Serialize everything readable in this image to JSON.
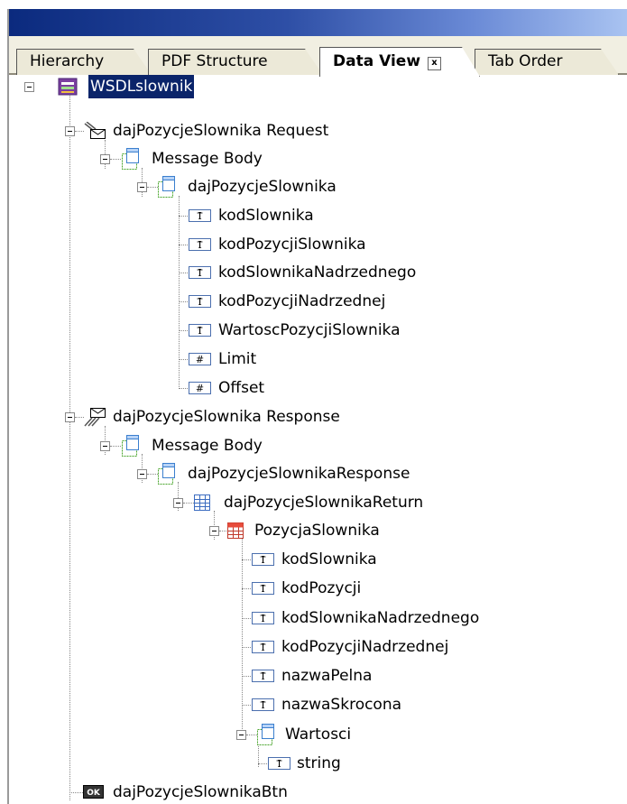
{
  "tabs": [
    {
      "label": "Hierarchy"
    },
    {
      "label": "PDF Structure"
    },
    {
      "label": "Data View",
      "close": "x"
    },
    {
      "label": "Tab Order"
    }
  ],
  "tree": {
    "root": "WSDLslownik",
    "request": {
      "label": "dajPozycjeSlownika Request",
      "body": "Message Body",
      "element": "dajPozycjeSlownika",
      "fields": [
        "kodSlownika",
        "kodPozycjiSlownika",
        "kodSlownikaNadrzednego",
        "kodPozycjiNadrzednej",
        "WartoscPozycjiSlownika",
        "Limit",
        "Offset"
      ]
    },
    "response": {
      "label": "dajPozycjeSlownika Response",
      "body": "Message Body",
      "element": "dajPozycjeSlownikaResponse",
      "return": "dajPozycjeSlownikaReturn",
      "item": "PozycjaSlownika",
      "fields": [
        "kodSlownika",
        "kodPozycji",
        "kodSlownikaNadrzednego",
        "kodPozycjiNadrzednej",
        "nazwaPelna",
        "nazwaSkrocona"
      ],
      "wartosci": "Wartosci",
      "string": "string"
    },
    "button": "dajPozycjeSlownikaBtn"
  }
}
